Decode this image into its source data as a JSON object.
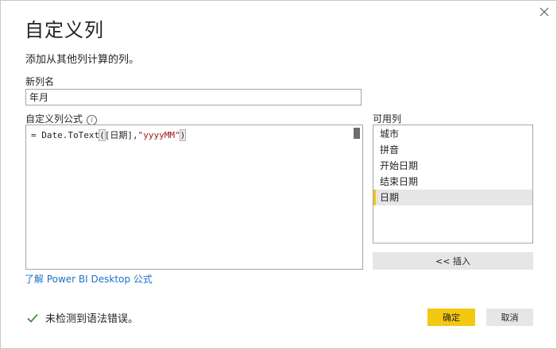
{
  "dialog": {
    "title": "自定义列",
    "subtitle": "添加从其他列计算的列。",
    "close_icon": "close-icon"
  },
  "new_column": {
    "label": "新列名",
    "value": "年月"
  },
  "formula": {
    "label": "自定义列公式",
    "info_icon": "info-icon",
    "prefix": "= Date.ToText",
    "open_paren": "(",
    "arg": "[日期],",
    "string_literal": "\"yyyyMM\"",
    "close_paren": ")"
  },
  "learn_link": "了解 Power BI Desktop 公式",
  "available_columns": {
    "label": "可用列",
    "items": [
      {
        "label": "城市"
      },
      {
        "label": "拼音"
      },
      {
        "label": "开始日期"
      },
      {
        "label": "结束日期"
      },
      {
        "label": "日期"
      }
    ],
    "selected": "日期",
    "insert_label": "<< 插入"
  },
  "status": {
    "icon": "checkmark-icon",
    "text": "未检测到语法错误。",
    "color": "#2e7d32"
  },
  "buttons": {
    "ok_label": "确定",
    "cancel_label": "取消",
    "accent": "#f2c811"
  }
}
